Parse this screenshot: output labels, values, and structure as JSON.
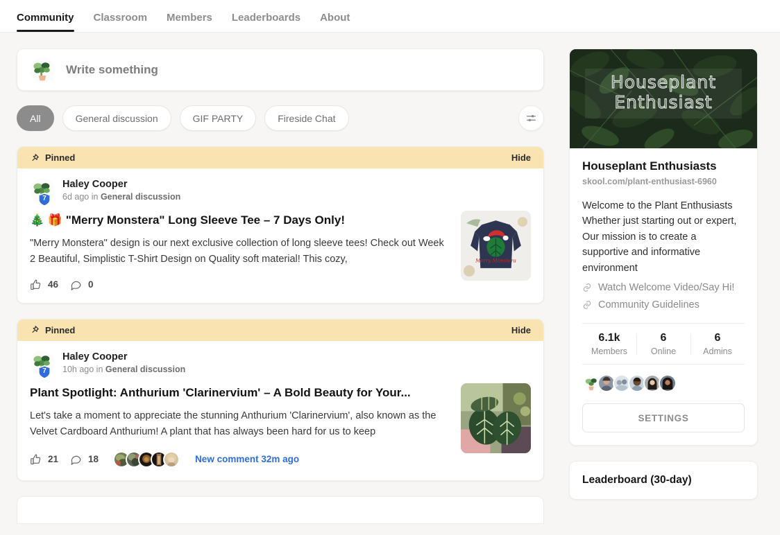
{
  "nav": {
    "tabs": [
      {
        "label": "Community",
        "active": true
      },
      {
        "label": "Classroom",
        "active": false
      },
      {
        "label": "Members",
        "active": false
      },
      {
        "label": "Leaderboards",
        "active": false
      },
      {
        "label": "About",
        "active": false
      }
    ]
  },
  "composer": {
    "placeholder": "Write something"
  },
  "filters": {
    "chips": [
      "All",
      "General discussion",
      "GIF PARTY",
      "Fireside Chat"
    ],
    "active": "All",
    "filter_icon": "sliders-icon"
  },
  "posts": [
    {
      "pinned_label": "Pinned",
      "hide_label": "Hide",
      "author": "Haley Cooper",
      "level_badge": "7",
      "time": "6d ago",
      "in_word": "in",
      "category": "General discussion",
      "title": "🎄 🎁 \"Merry Monstera\" Long Sleeve Tee – 7 Days Only!",
      "text": "\"Merry Monstera\" design is our next exclusive collection of long sleeve tees! Check out Week 2 Beautiful, Simplistic T-Shirt Design on Quality soft material! This cozy,",
      "likes": "46",
      "comments": "0",
      "thumbnail": "navy-long-sleeve-tee-monstera-santa-hat",
      "new_comment": "",
      "commenters": 0
    },
    {
      "pinned_label": "Pinned",
      "hide_label": "Hide",
      "author": "Haley Cooper",
      "level_badge": "7",
      "time": "10h ago",
      "in_word": "in",
      "category": "General discussion",
      "title": "Plant Spotlight: Anthurium 'Clarinervium' – A Bold Beauty for Your...",
      "text": "Let's take a moment to appreciate the stunning Anthurium 'Clarinervium', also known as the Velvet Cardboard Anthurium! A plant that has always been hard for us to keep",
      "likes": "21",
      "comments": "18",
      "thumbnail": "anthurium-clarinervium-leaves-photo",
      "new_comment": "New comment 32m ago",
      "commenters": 5
    }
  ],
  "sidebar": {
    "banner_title_line1": "Houseplant",
    "banner_title_line2": "Enthusiast",
    "name": "Houseplant Enthusiasts",
    "url": "skool.com/plant-enthusiast-6960",
    "description": "Welcome to the Plant Enthusiasts\nWhether just starting out or expert, Our mission is to create a supportive and informative environment",
    "links": [
      {
        "label": "Watch Welcome Video/Say Hi!",
        "icon": "link-icon"
      },
      {
        "label": "Community Guidelines",
        "icon": "link-icon"
      }
    ],
    "stats": [
      {
        "value": "6.1k",
        "label": "Members"
      },
      {
        "value": "6",
        "label": "Online"
      },
      {
        "value": "6",
        "label": "Admins"
      }
    ],
    "member_avatars": 6,
    "settings_label": "SETTINGS",
    "leaderboard_title": "Leaderboard (30-day)"
  },
  "colors": {
    "page_bg": "#f7f6f4",
    "pinned_bg": "#f8e3b1",
    "link_blue": "#2f6ddb",
    "chip_active_bg": "#8c8c8c",
    "badge_blue": "#2f6ddb"
  }
}
